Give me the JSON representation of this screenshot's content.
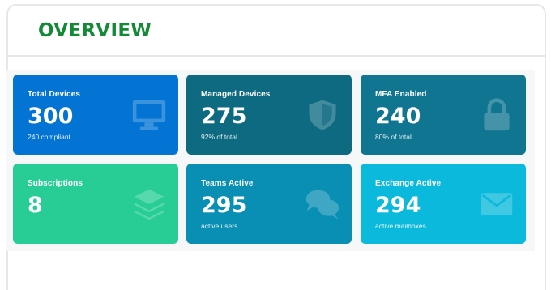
{
  "overview": {
    "title": "OVERVIEW"
  },
  "cards": [
    {
      "label": "Total Devices",
      "value": "300",
      "sub": "240 compliant",
      "icon": "monitor-icon",
      "color": "#0474d4"
    },
    {
      "label": "Managed Devices",
      "value": "275",
      "sub": "92% of total",
      "icon": "shield-icon",
      "color": "#0d6a80"
    },
    {
      "label": "MFA Enabled",
      "value": "240",
      "sub": "80% of total",
      "icon": "lock-icon",
      "color": "#0f7591"
    },
    {
      "label": "Subscriptions",
      "value": "8",
      "sub": "",
      "icon": "layers-icon",
      "color": "#28cd96"
    },
    {
      "label": "Teams Active",
      "value": "295",
      "sub": "active users",
      "icon": "chat-bubbles-icon",
      "color": "#098fb3"
    },
    {
      "label": "Exchange Active",
      "value": "294",
      "sub": "active mailboxes",
      "icon": "envelope-icon",
      "color": "#0bb9dc"
    }
  ],
  "colors": {
    "title": "#138a36",
    "border": "#e4e7ec",
    "grid_background": "#f5f7f9"
  }
}
